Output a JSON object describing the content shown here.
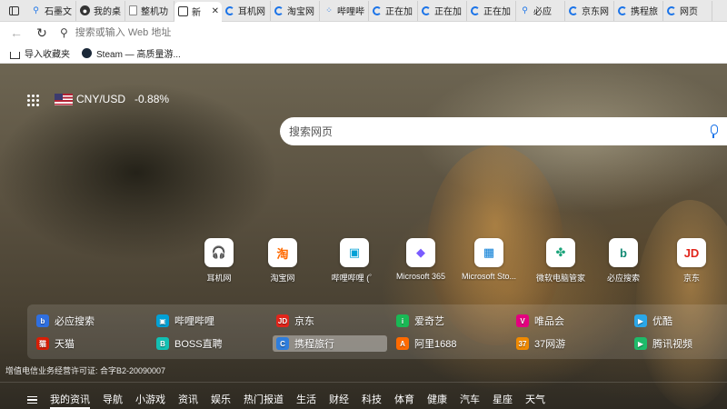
{
  "tabs": [
    {
      "label": "石墨文",
      "icon": "search-icon",
      "active": false
    },
    {
      "label": "我的桌",
      "icon": "circle-icon",
      "active": false
    },
    {
      "label": "整机功",
      "icon": "document-icon",
      "active": false
    },
    {
      "label": "新",
      "icon": "newtab-icon",
      "active": true
    },
    {
      "label": "耳机网",
      "icon": "loading-icon",
      "active": false
    },
    {
      "label": "淘宝网",
      "icon": "loading-icon",
      "active": false
    },
    {
      "label": "哔哩哔",
      "icon": "loading-dots-icon",
      "active": false
    },
    {
      "label": "正在加",
      "icon": "loading-icon",
      "active": false
    },
    {
      "label": "正在加",
      "icon": "loading-icon",
      "active": false
    },
    {
      "label": "正在加",
      "icon": "loading-icon",
      "active": false
    },
    {
      "label": "必应",
      "icon": "search-icon",
      "active": false
    },
    {
      "label": "京东网",
      "icon": "loading-icon",
      "active": false
    },
    {
      "label": "携程旅",
      "icon": "loading-icon",
      "active": false
    },
    {
      "label": "网页",
      "icon": "loading-icon",
      "active": false
    }
  ],
  "toolbar": {
    "address_placeholder": "搜索或输入 Web 地址"
  },
  "favorites": {
    "import_label": "导入收藏夹",
    "steam_label": "Steam — 高质量游..."
  },
  "widgets": {
    "currency_pair": "CNY/USD",
    "currency_change": "-0.88%"
  },
  "search": {
    "placeholder": "搜索网页"
  },
  "quick_links": [
    {
      "label": "耳机网",
      "glyph": "🎧",
      "color": "#222"
    },
    {
      "label": "淘宝网",
      "glyph": "淘",
      "color": "#ff6a00"
    },
    {
      "label": "哔哩哔哩 (゜",
      "glyph": "▣",
      "color": "#00a1d6"
    },
    {
      "label": "Microsoft 365",
      "glyph": "◆",
      "color": "#7a5cff"
    },
    {
      "label": "Microsoft Sto...",
      "glyph": "▦",
      "color": "#0078d4"
    },
    {
      "label": "微软电脑管家",
      "glyph": "✤",
      "color": "#1aa37a"
    },
    {
      "label": "必应搜索",
      "glyph": "b",
      "color": "#138a74"
    },
    {
      "label": "京东",
      "glyph": "JD",
      "color": "#e1251b"
    }
  ],
  "sites": [
    {
      "label": "必应搜索",
      "color": "#2f6fe0",
      "glyph": "b"
    },
    {
      "label": "哔哩哔哩",
      "color": "#00a1d6",
      "glyph": "▣"
    },
    {
      "label": "京东",
      "color": "#e1251b",
      "glyph": "JD"
    },
    {
      "label": "爱奇艺",
      "color": "#19b955",
      "glyph": "i"
    },
    {
      "label": "唯品会",
      "color": "#e4007f",
      "glyph": "V"
    },
    {
      "label": "优酷",
      "color": "#2aa7e8",
      "glyph": "▶"
    },
    {
      "label": "天猫",
      "color": "#d81e06",
      "glyph": "猫"
    },
    {
      "label": "BOSS直聘",
      "color": "#12c0b3",
      "glyph": "B"
    },
    {
      "label": "携程旅行",
      "color": "#2e7ddc",
      "glyph": "C"
    },
    {
      "label": "阿里1688",
      "color": "#ff6a00",
      "glyph": "A"
    },
    {
      "label": "37网游",
      "color": "#f08a00",
      "glyph": "37"
    },
    {
      "label": "腾讯视频",
      "color": "#1ebb6a",
      "glyph": "▶"
    }
  ],
  "license_text": "增值电信业务经营许可证: 合字B2-20090007",
  "bottom_nav": [
    "我的资讯",
    "导航",
    "小游戏",
    "资讯",
    "娱乐",
    "热门报道",
    "生活",
    "财经",
    "科技",
    "体育",
    "健康",
    "汽车",
    "星座",
    "天气"
  ]
}
